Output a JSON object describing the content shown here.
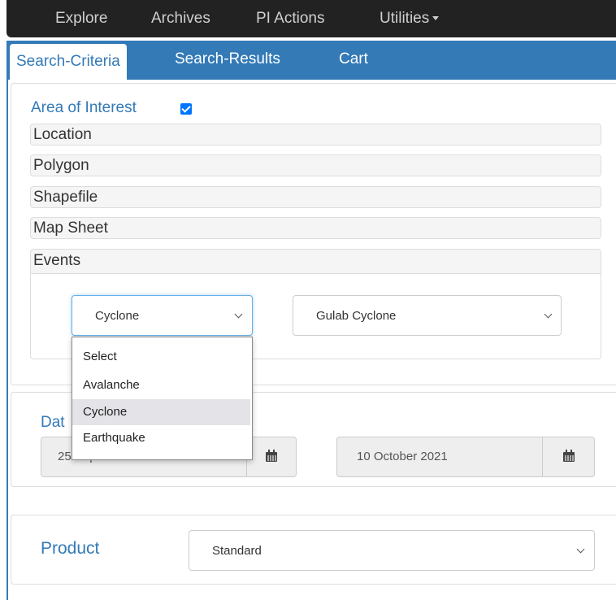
{
  "nav": {
    "items": [
      "Explore",
      "Archives",
      "PI Actions",
      "Utilities"
    ]
  },
  "tabs": [
    "Search-Criteria",
    "Search-Results",
    "Cart"
  ],
  "area_of_interest": {
    "title": "Area of Interest",
    "checked": true,
    "sections": [
      "Location",
      "Polygon",
      "Shapefile",
      "Map Sheet",
      "Events"
    ]
  },
  "events": {
    "type_select": {
      "value": "Cyclone",
      "options": [
        "Select",
        "Avalanche",
        "Cyclone",
        "Earthquake"
      ],
      "highlighted": "Cyclone"
    },
    "event_select": {
      "value": "Gulab Cyclone"
    }
  },
  "date": {
    "title": "Dat",
    "start": "25 September 2021",
    "end": "10 October 2021"
  },
  "product": {
    "label": "Product",
    "value": "Standard"
  },
  "colors": {
    "accent": "#337ab7",
    "nav_bg": "#222222",
    "focus": "#66afe9"
  }
}
